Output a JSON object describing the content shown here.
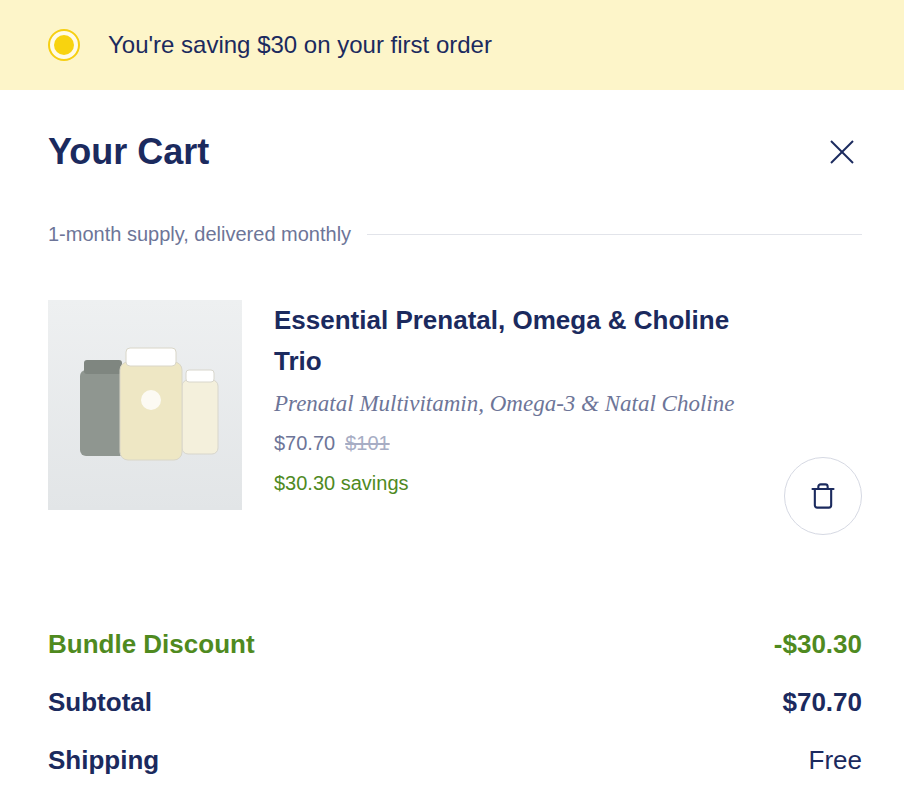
{
  "banner": {
    "text": "You're saving $30 on your first order"
  },
  "cart": {
    "title": "Your Cart",
    "plan": "1-month supply, delivered monthly"
  },
  "items": [
    {
      "name": "Essential Prenatal, Omega & Choline Trio",
      "description": "Prenatal Multivitamin, Omega-3 & Natal Choline",
      "price": "$70.70",
      "original_price": "$101",
      "savings": "$30.30 savings"
    }
  ],
  "summary": [
    {
      "label": "Bundle Discount",
      "value": "-$30.30",
      "kind": "discount"
    },
    {
      "label": "Subtotal",
      "value": "$70.70",
      "kind": "total"
    },
    {
      "label": "Shipping",
      "value": "Free",
      "kind": "plain"
    }
  ]
}
